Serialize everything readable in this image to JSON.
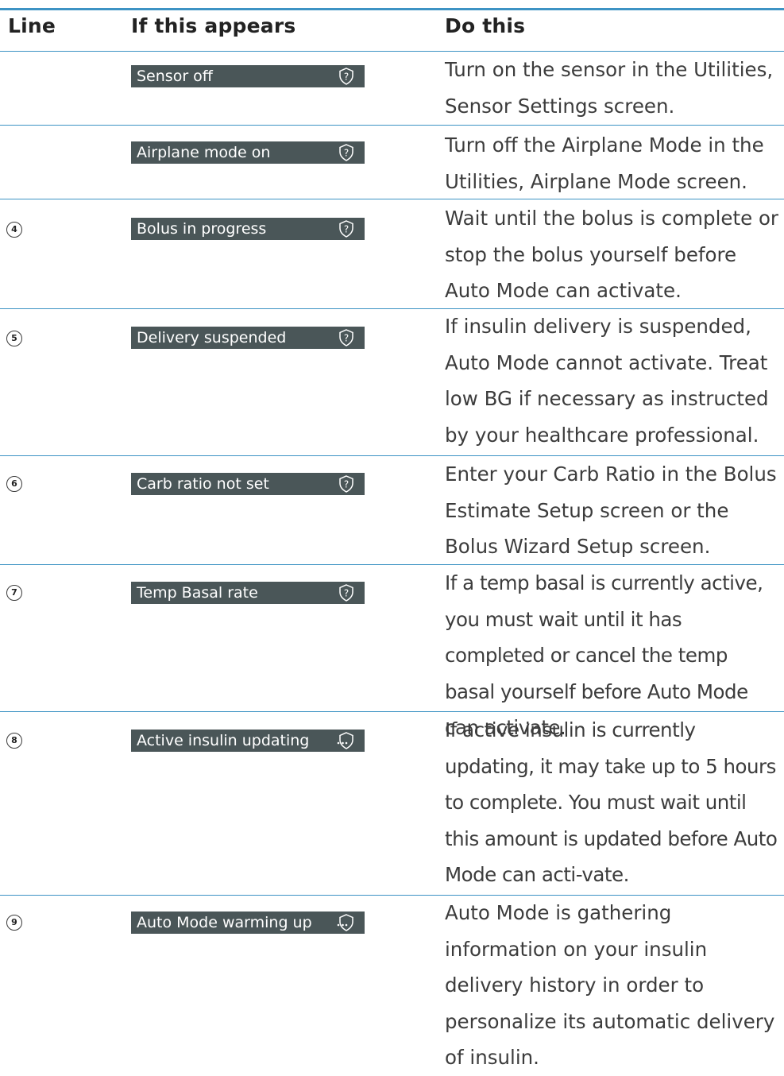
{
  "header": {
    "col_line": "Line",
    "col_appears": "If this appears",
    "col_do": "Do this"
  },
  "rows": [
    {
      "line": "",
      "message": "Sensor off",
      "icon": "shield-question-icon",
      "action": "Turn on the sensor in the Utilities, Sensor Settings screen."
    },
    {
      "line": "",
      "message": "Airplane mode on",
      "icon": "shield-question-icon",
      "action": "Turn off the Airplane Mode in the Utilities, Airplane Mode screen."
    },
    {
      "line": "4",
      "message": "Bolus in progress",
      "icon": "shield-question-icon",
      "action": "Wait until the bolus is complete or stop the bolus yourself before Auto Mode can activate."
    },
    {
      "line": "5",
      "message": "Delivery suspended",
      "icon": "shield-question-icon",
      "action": "If insulin delivery is suspended, Auto Mode cannot activate. Treat low BG if necessary as instructed by your healthcare professional."
    },
    {
      "line": "6",
      "message": "Carb ratio not set",
      "icon": "shield-question-icon",
      "action": "Enter your Carb Ratio in the Bolus Estimate Setup screen or the Bolus Wizard Setup screen."
    },
    {
      "line": "7",
      "message": "Temp Basal rate",
      "icon": "shield-question-icon",
      "action": "If a temp basal is currently active, you must wait until it has completed or cancel the temp basal yourself before Auto Mode can activate."
    },
    {
      "line": "8",
      "message": "Active insulin updating",
      "icon": "shield-dots-icon",
      "action": "If active insulin is currently updating, it may take up to 5 hours to complete. You must wait until this amount is updated before Auto Mode can acti-vate."
    },
    {
      "line": "9",
      "message": "Auto Mode warming up",
      "icon": "shield-dots-icon",
      "action": "Auto Mode is gathering information on your insulin delivery history in order to personalize its automatic delivery of insulin."
    }
  ]
}
